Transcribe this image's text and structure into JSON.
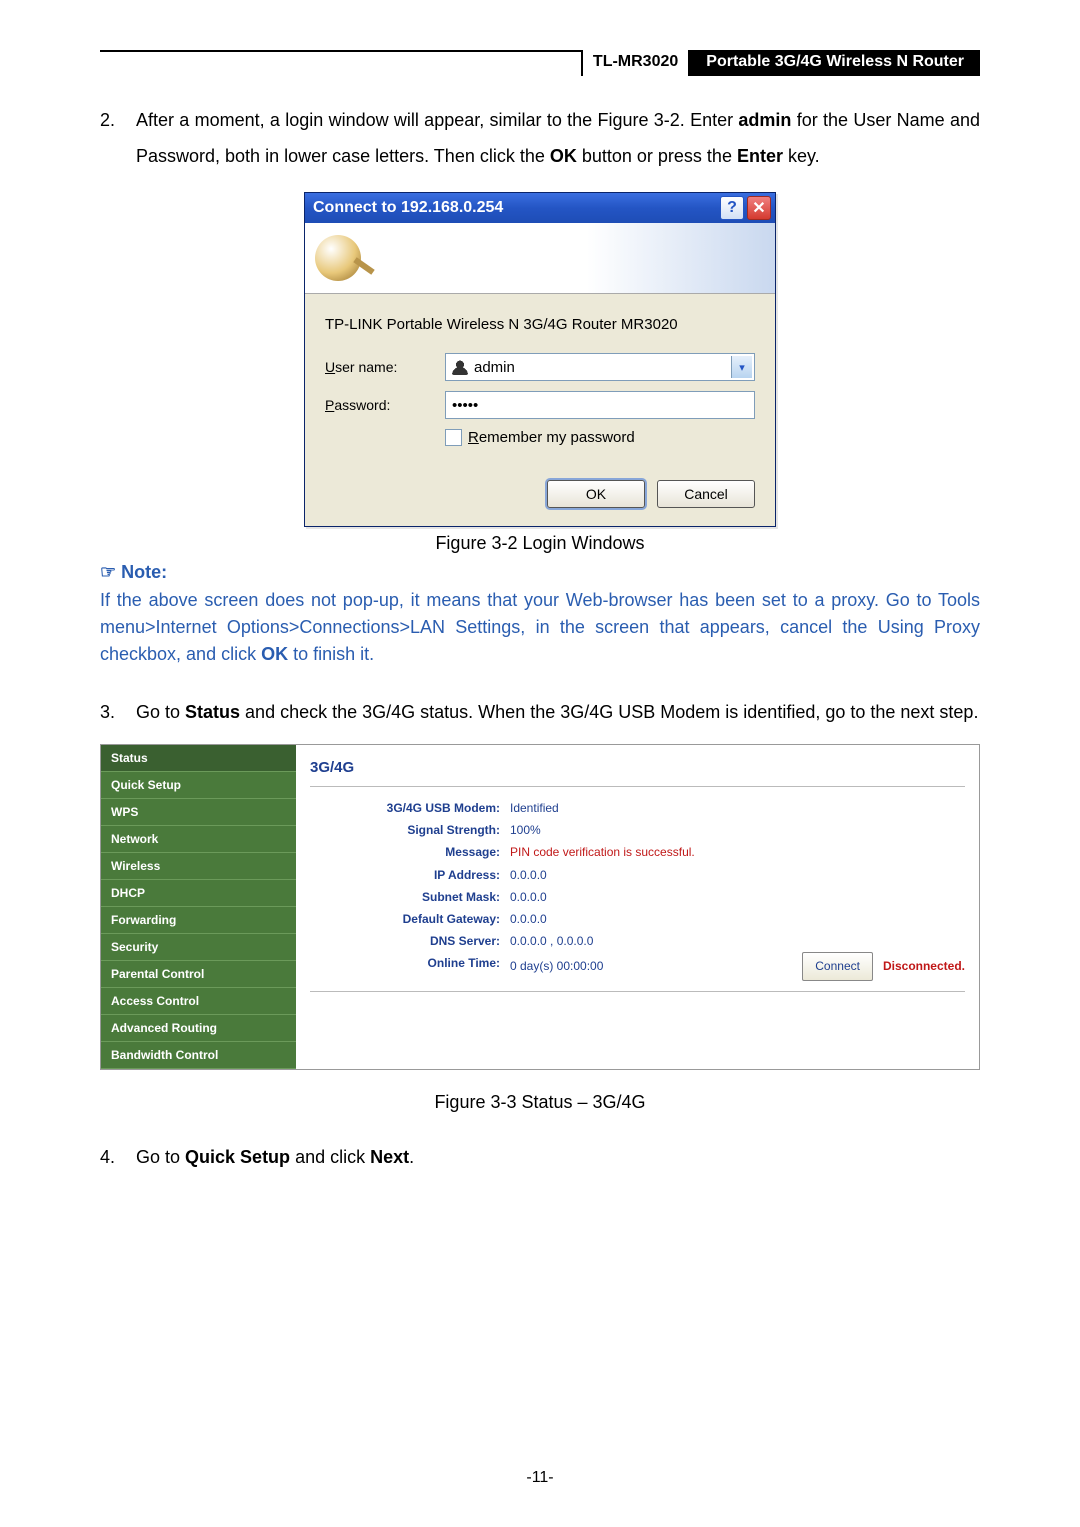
{
  "header": {
    "model": "TL-MR3020",
    "product": "Portable 3G/4G Wireless N Router"
  },
  "step2": {
    "num": "2.",
    "text_a": "After a moment, a login window will appear, similar to the Figure 3-2. Enter ",
    "bold_a": "admin",
    "text_b": " for the User Name and Password, both in lower case letters. Then click the ",
    "bold_b": "OK",
    "text_c": " button or press the ",
    "bold_c": "Enter",
    "text_d": " key."
  },
  "login": {
    "title": "Connect to 192.168.0.254",
    "desc": "TP-LINK Portable Wireless N 3G/4G Router MR3020",
    "username_label": "User name:",
    "username_value": "admin",
    "password_label": "Password:",
    "password_value": "•••••",
    "remember_label": "Remember my password",
    "ok": "OK",
    "cancel": "Cancel"
  },
  "fig32_caption": "Figure 3-2    Login Windows",
  "note": {
    "head": "☞  Note:",
    "body_a": "If the above screen does not pop-up, it means that your Web-browser has been set to a proxy. Go to Tools menu>Internet Options>Connections>LAN Settings, in the screen that appears, cancel the Using Proxy checkbox, and click ",
    "bold": "OK",
    "body_b": " to finish it."
  },
  "step3": {
    "num": "3.",
    "text_a": "Go to ",
    "bold_a": "Status",
    "text_b": " and check the 3G/4G status. When the 3G/4G USB Modem is identified, go to the next step."
  },
  "statusPanel": {
    "menu": [
      "Status",
      "Quick Setup",
      "WPS",
      "Network",
      "Wireless",
      "DHCP",
      "Forwarding",
      "Security",
      "Parental Control",
      "Access Control",
      "Advanced Routing",
      "Bandwidth Control"
    ],
    "heading": "3G/4G",
    "rows": [
      {
        "k": "3G/4G USB Modem:",
        "v": "Identified"
      },
      {
        "k": "Signal Strength:",
        "v": "100%"
      },
      {
        "k": "Message:",
        "v": "PIN code verification is successful.",
        "red": true
      },
      {
        "k": "IP Address:",
        "v": "0.0.0.0"
      },
      {
        "k": "Subnet Mask:",
        "v": "0.0.0.0"
      },
      {
        "k": "Default Gateway:",
        "v": "0.0.0.0"
      },
      {
        "k": "DNS Server:",
        "v": "0.0.0.0 , 0.0.0.0"
      }
    ],
    "online_k": "Online Time:",
    "online_v": "0 day(s) 00:00:00",
    "connect_btn": "Connect",
    "disc": "Disconnected."
  },
  "fig33_caption": "Figure 3-3    Status – 3G/4G",
  "step4": {
    "num": "4.",
    "text_a": "Go to ",
    "bold_a": "Quick Setup",
    "text_b": " and click ",
    "bold_b": "Next",
    "text_c": "."
  },
  "pagenum": "-11-"
}
